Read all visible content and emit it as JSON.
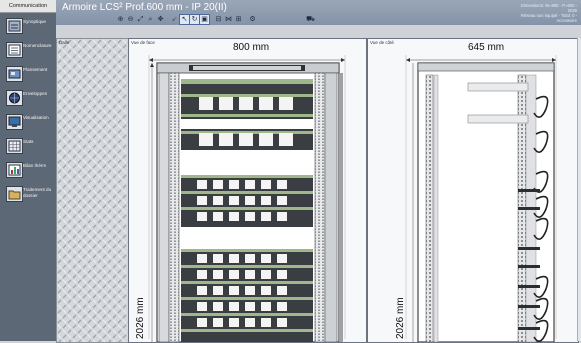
{
  "sidebar": {
    "header": "Communication",
    "items": [
      {
        "label": "Synoptique",
        "icon": "synoptic-icon"
      },
      {
        "label": "Nomenclature",
        "icon": "list-icon"
      },
      {
        "label": "Plansement",
        "icon": "plan-icon"
      },
      {
        "label": "Enveloppes",
        "icon": "globe-icon"
      },
      {
        "label": "Visualisation",
        "icon": "monitor-icon"
      },
      {
        "label": "Stats",
        "icon": "grid-icon"
      },
      {
        "label": "Bilan thérm",
        "icon": "chart-icon"
      },
      {
        "label": "Traitement du dossier",
        "icon": "folder-icon"
      }
    ]
  },
  "titlebar": {
    "title": "Armoire LCS² Prof.600 mm - IP 20(II)",
    "status_line1": "Dimensions: W=800 - P=600 - 2026",
    "status_line2": "Réseau non équipé - Total: 0 - Accessoire"
  },
  "toolbar": {
    "icons": [
      "🔍",
      "🔍",
      "⤢",
      "⌕",
      "⌖",
      "⛶",
      "⌕",
      "⊞",
      "⊡",
      "⊟",
      "⊠",
      "≋",
      "⊛",
      "⛵"
    ]
  },
  "panels": {
    "plate": {
      "label": "Dalle"
    },
    "front": {
      "label": "Vue de face",
      "width_dim": "800 mm",
      "height_dim": "2026 mm"
    },
    "side": {
      "label": "Vue de côté",
      "width_dim": "645 mm",
      "height_dim": "2026 mm"
    }
  }
}
